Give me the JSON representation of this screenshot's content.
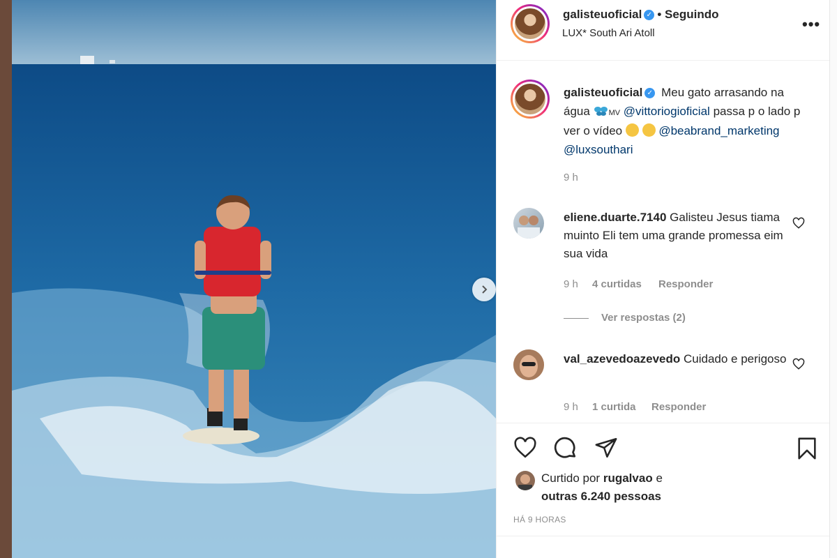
{
  "post": {
    "username": "galisteuoficial",
    "follow_status": "• Seguindo",
    "location": "LUX* South Ari Atoll",
    "more_label": "•••",
    "caption_part1": "Meu gato arrasando na água",
    "caption_mv": "MV",
    "mention1": "@vittoriogioficial",
    "caption_part2": "passa p o lado p ver o vídeo",
    "mention2": "@beabrand_marketing",
    "mention3": "@luxsouthari",
    "caption_time": "9 h"
  },
  "comments": [
    {
      "username": "eliene.duarte.7140",
      "text": "Galisteu Jesus tiama muinto Eli tem uma grande promessa eim sua vida",
      "time": "9 h",
      "likes": "4 curtidas",
      "reply": "Responder",
      "view_replies": "Ver respostas (2)"
    },
    {
      "username": "val_azevedoazevedo",
      "text": "Cuidado e perigoso",
      "time": "9 h",
      "likes": "1 curtida",
      "reply": "Responder"
    }
  ],
  "likes": {
    "prefix": "Curtido por",
    "user": "rugalvao",
    "and": "e",
    "others": "outras 6.240 pessoas"
  },
  "posted_ago": "HÁ 9 HORAS",
  "colors": {
    "link": "#00376b",
    "verified": "#3897f0",
    "muted": "#8e8e8e"
  }
}
